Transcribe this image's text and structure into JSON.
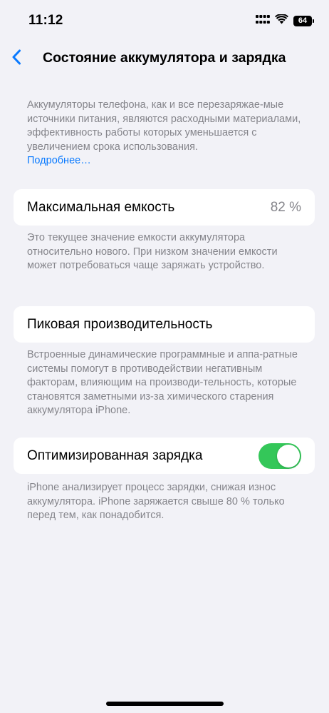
{
  "status_bar": {
    "time": "11:12",
    "battery_level": "64",
    "icons": [
      "signal-icon",
      "wifi-icon",
      "battery-icon"
    ]
  },
  "nav": {
    "back_icon": "chevron-left-icon",
    "title": "Состояние аккумулятора и зарядка"
  },
  "intro": {
    "text": "Аккумуляторы телефона, как и все перезаряжае-мые источники питания, являются расходными материалами, эффективность работы которых уменьшается с увеличением срока использования.",
    "more_link": "Подробнее…"
  },
  "max_capacity": {
    "label": "Максимальная емкость",
    "value": "82 %",
    "footer": "Это текущее значение емкости аккумулятора относительно нового. При низком значении емкости может потребоваться чаще заряжать устройство."
  },
  "peak_performance": {
    "label": "Пиковая производительность",
    "footer": "Встроенные динамические программные и аппа-ратные системы помогут в противодействии негативным факторам, влияющим на производи-тельность, которые становятся заметными из-за химического старения аккумулятора iPhone."
  },
  "optimized_charging": {
    "label": "Оптимизированная зарядка",
    "enabled": true,
    "footer": "iPhone анализирует процесс зарядки, снижая износ аккумулятора. iPhone заряжается свыше 80 % только перед тем, как понадобится."
  },
  "colors": {
    "accent": "#0a7aff",
    "toggle_on": "#34c759",
    "background": "#f2f2f7",
    "secondary_text": "#85858b"
  }
}
